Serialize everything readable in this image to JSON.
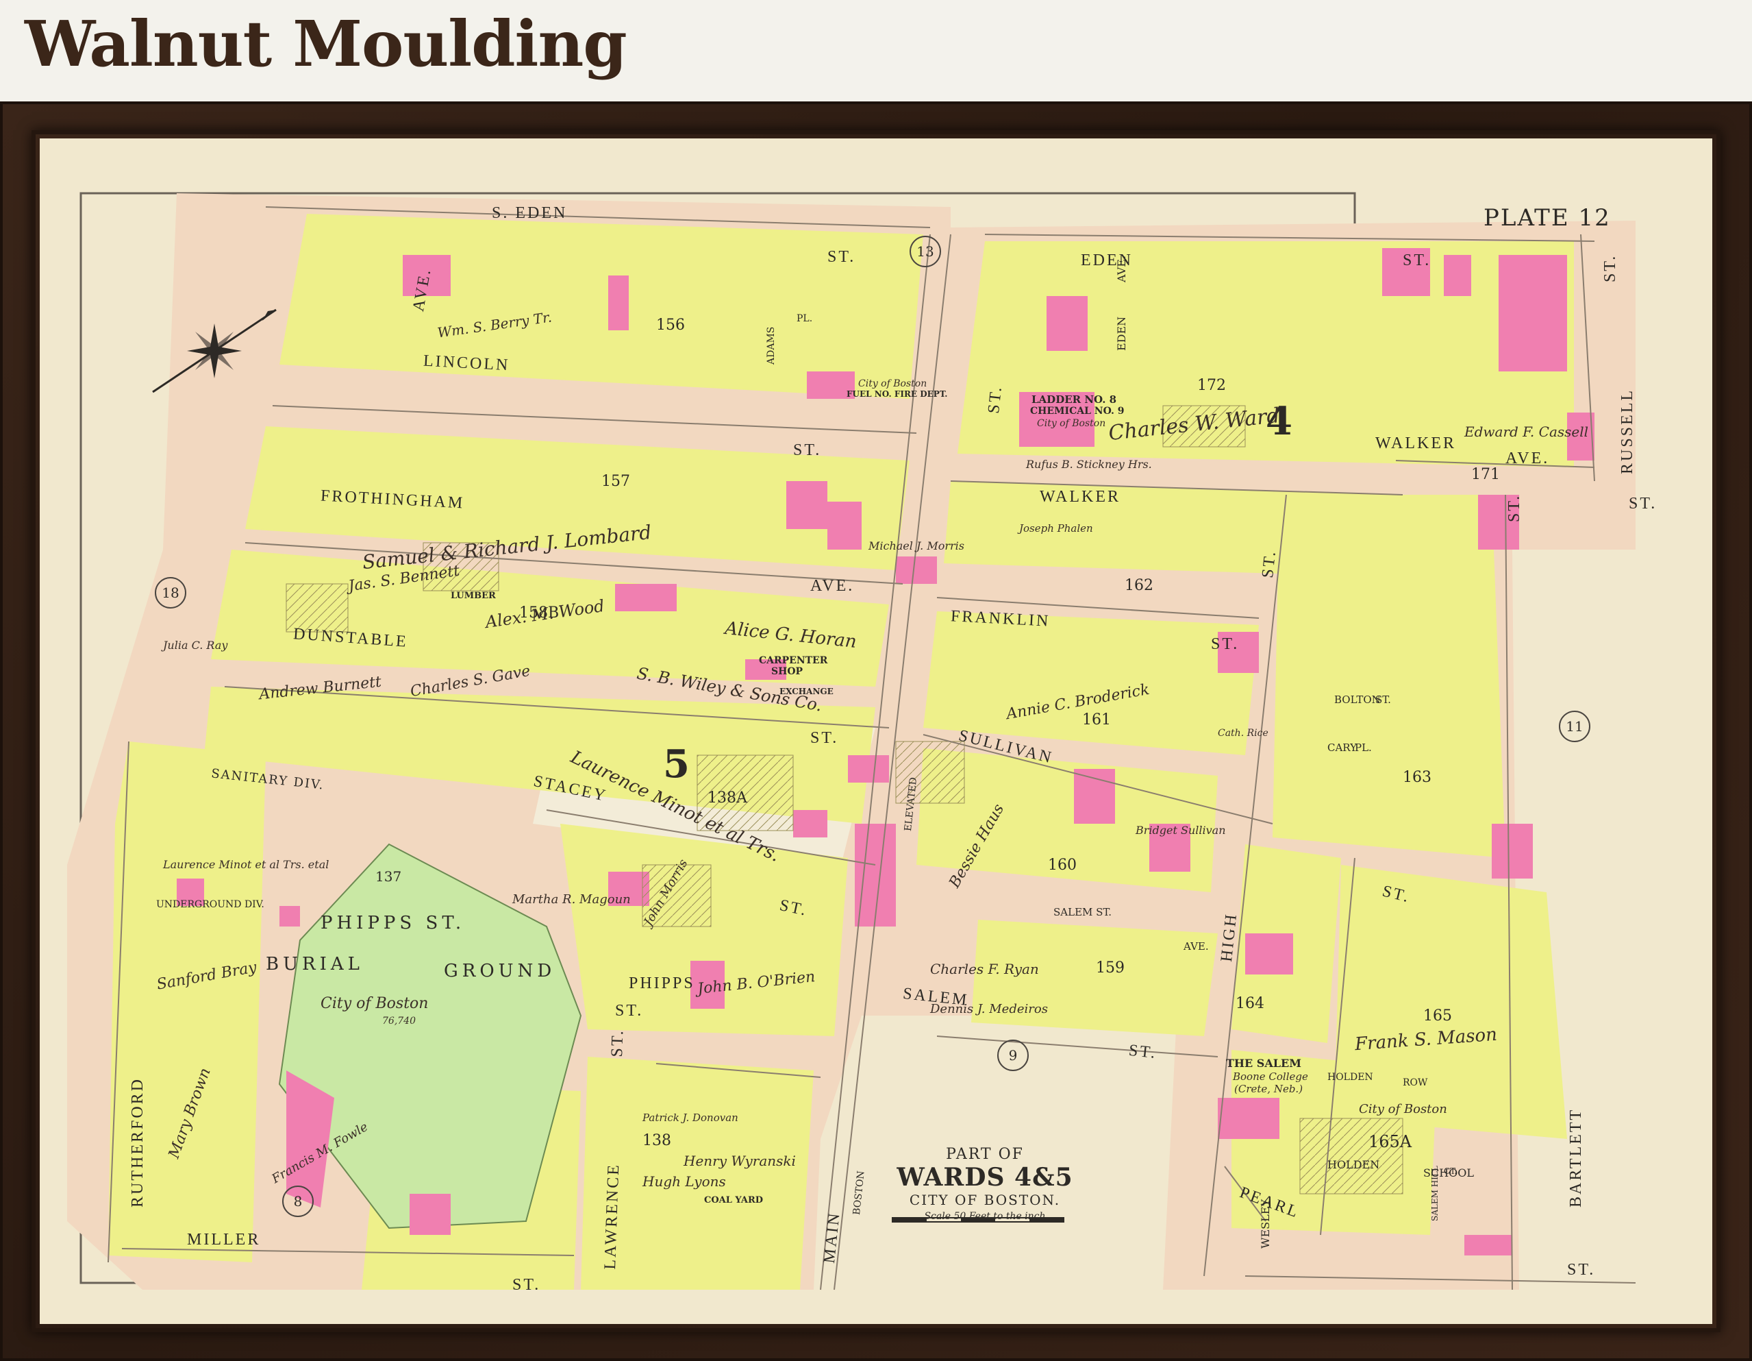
{
  "header": {
    "title": "Walnut Moulding"
  },
  "colors": {
    "frame": "#2f1e14",
    "paper": "#f1e8ce",
    "yellow": "#eef08a",
    "pink": "#f07fb0",
    "green": "#c9e8a4",
    "street": "#f2d8c0",
    "ink": "#2d2a26"
  },
  "map": {
    "plate": "PLATE 12",
    "title": {
      "line1": "PART OF",
      "line2": "WARDS 4&5",
      "line3": "CITY OF BOSTON.",
      "scale": "Scale 50 Feet to the inch"
    },
    "streets": [
      "S. EDEN",
      "ST.",
      "EDEN",
      "ST.",
      "LINCOLN",
      "ST.",
      "FROTHINGHAM",
      "AVE.",
      "DUNSTABLE",
      "ST.",
      "STACEY",
      "ST.",
      "MILLER",
      "ST.",
      "PHIPPS",
      "ST.",
      "SALEM",
      "ST.",
      "SULLIVAN",
      "ST.",
      "FRANKLIN",
      "ST.",
      "WALKER",
      "ST.",
      "WALKER",
      "AVE.",
      "HIGH",
      "ST.",
      "PEARL",
      "ST.",
      "BOLTON",
      "ST.",
      "CARY",
      "PL.",
      "SALEM ST.",
      "AVE.",
      "RUTHERFORD",
      "AVE.",
      "MAIN",
      "ST.",
      "LAWRENCE",
      "ST.",
      "BARTLETT",
      "ST.",
      "RUSSELL",
      "ST.",
      "ADAMS",
      "PL.",
      "ELEVATED",
      "BOSTON",
      "WESLEY",
      "HOLDEN",
      "ROW",
      "SALEM HILL",
      "CT.",
      "EDEN",
      "AVE."
    ],
    "ward_numbers": [
      "13",
      "18",
      "8",
      "11",
      "9"
    ],
    "block_numbers": [
      "156",
      "157",
      "158B",
      "138A",
      "137",
      "138",
      "162",
      "161",
      "160",
      "159",
      "163",
      "164",
      "165",
      "165A",
      "171",
      "172"
    ],
    "ward_big": [
      "5",
      "4"
    ],
    "features": {
      "burial_ground": [
        "PHIPPS ST.",
        "BURIAL",
        "GROUND",
        "City of Boston",
        "76,740"
      ],
      "ladder": [
        "LADDER NO. 8",
        "CHEMICAL NO. 9",
        "City of Boston"
      ],
      "fire_dept": [
        "City of Boston",
        "FUEL NO. FIRE DEPT."
      ],
      "sanitary": "SANITARY DIV.",
      "underground": "UNDERGROUND DIV.",
      "lumber": "LUMBER",
      "carpenter": [
        "CARPENTER",
        "SHOP"
      ],
      "exchange": "EXCHANGE",
      "coal_yard": "COAL YARD",
      "the_salem": [
        "THE SALEM",
        "Boone College",
        "(Crete, Neb.)"
      ],
      "holden_school": [
        "City of Boston",
        "HOLDEN",
        "SCHOOL"
      ]
    },
    "owners": [
      "Wm. S. Berry Tr.",
      "Samuel & Richard J. Lombard",
      "Jas. S. Bennett",
      "Alex. M. Wood",
      "Alice G. Horan",
      "S. B. Wiley & Sons Co.",
      "Andrew Burnett",
      "Charles S. Gave",
      "Laurence Minot et al Trs.",
      "Martha R. Magoun",
      "John B. O'Brien",
      "Annie C. Broderick",
      "Charles W. Ward",
      "Frank S. Mason",
      "Bessie Haus",
      "Charles F. Ryan",
      "Dennis J. Medeiros",
      "Henry Wyranski",
      "Hugh Lyons",
      "Sanford Bray",
      "Mary Brown",
      "Francis M. Fowle",
      "John Morris",
      "Michael J. Morris",
      "Edward F. Cassell",
      "Rufus B. Stickney Hrs.",
      "Bridget Sullivan",
      "Laurence Minot et al Trs. etal",
      "Julia C. Ray",
      "Patrick J. Donovan",
      "Joseph Phalen",
      "Cath. Rice"
    ]
  }
}
